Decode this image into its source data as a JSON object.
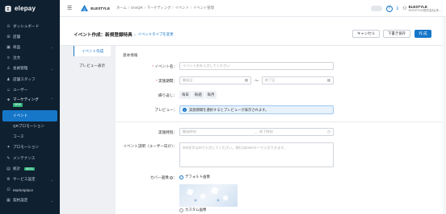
{
  "brand": {
    "name": "elepay"
  },
  "sidebar": {
    "items": [
      {
        "label": "ダッシュボード",
        "icon": "dashboard-icon"
      },
      {
        "label": "店舗",
        "icon": "store-icon"
      },
      {
        "label": "商品",
        "icon": "product-icon"
      },
      {
        "label": "注文",
        "icon": "order-icon"
      },
      {
        "label": "会員管理",
        "icon": "member-icon"
      },
      {
        "label": "店舗スタッフ",
        "icon": "staff-icon"
      },
      {
        "label": "ユーザー",
        "icon": "user-icon"
      },
      {
        "label": "マーケティング",
        "icon": "marketing-icon",
        "badge": "NEW"
      },
      {
        "label": "イベント",
        "icon": "",
        "active": true
      },
      {
        "label": "QRプロモーション",
        "icon": ""
      },
      {
        "label": "コース",
        "icon": ""
      },
      {
        "label": "プロモーション",
        "icon": "promotion-icon"
      },
      {
        "label": "メンテナンス",
        "icon": "maintenance-icon"
      },
      {
        "label": "統計",
        "icon": "stats-icon",
        "badge": "BETA"
      },
      {
        "label": "サービス設定",
        "icon": "settings-icon"
      },
      {
        "label": "Marketplace",
        "icon": "marketplace-icon"
      },
      {
        "label": "契約設定",
        "icon": "contract-icon"
      }
    ]
  },
  "topbar": {
    "store_name": "ELESTYLE",
    "breadcrumb": [
      "ホーム",
      "OneQR",
      "マーケティング",
      "イベント",
      "イベント管理"
    ],
    "user_name": "ELESTYLE",
    "user_sub": "ELESTYLE株式会社(本..."
  },
  "page": {
    "title": "イベント作成：新規登録特典",
    "type_link": "← イベントタイプを変更",
    "cancel_label": "キャンセル",
    "draft_label": "下書き保存",
    "create_label": "作 成"
  },
  "tabs": [
    {
      "label": "イベント作成",
      "active": true
    },
    {
      "label": "プレビュー表示",
      "active": false
    }
  ],
  "form": {
    "section": "基本情報",
    "event_name_label": "イベント名",
    "event_name_placeholder": "イベント名を入力してください",
    "period_label": "実施期間",
    "start_placeholder": "開始日",
    "end_placeholder": "終了日",
    "repeat_label": "繰り返し",
    "repeat_options": [
      "毎日",
      "毎週",
      "毎月"
    ],
    "preview_label": "プレビュー",
    "preview_message": "実施期間を選択するとプレビューが表示されます。",
    "time_label": "実施時刻",
    "start_time_placeholder": "開始時刻",
    "end_time_placeholder": "終了時刻",
    "desc_label": "イベント説明（ユーザー向け）",
    "desc_placeholder": "300文字以内で入力してください。改行はEnterキーで入力できます。",
    "cover_label": "カバー画像",
    "cover_default": "デフォルト画像",
    "cover_custom": "カスタム画像"
  },
  "colors": {
    "accent": "#1677c9",
    "sidebar_bg": "#0f2030"
  }
}
